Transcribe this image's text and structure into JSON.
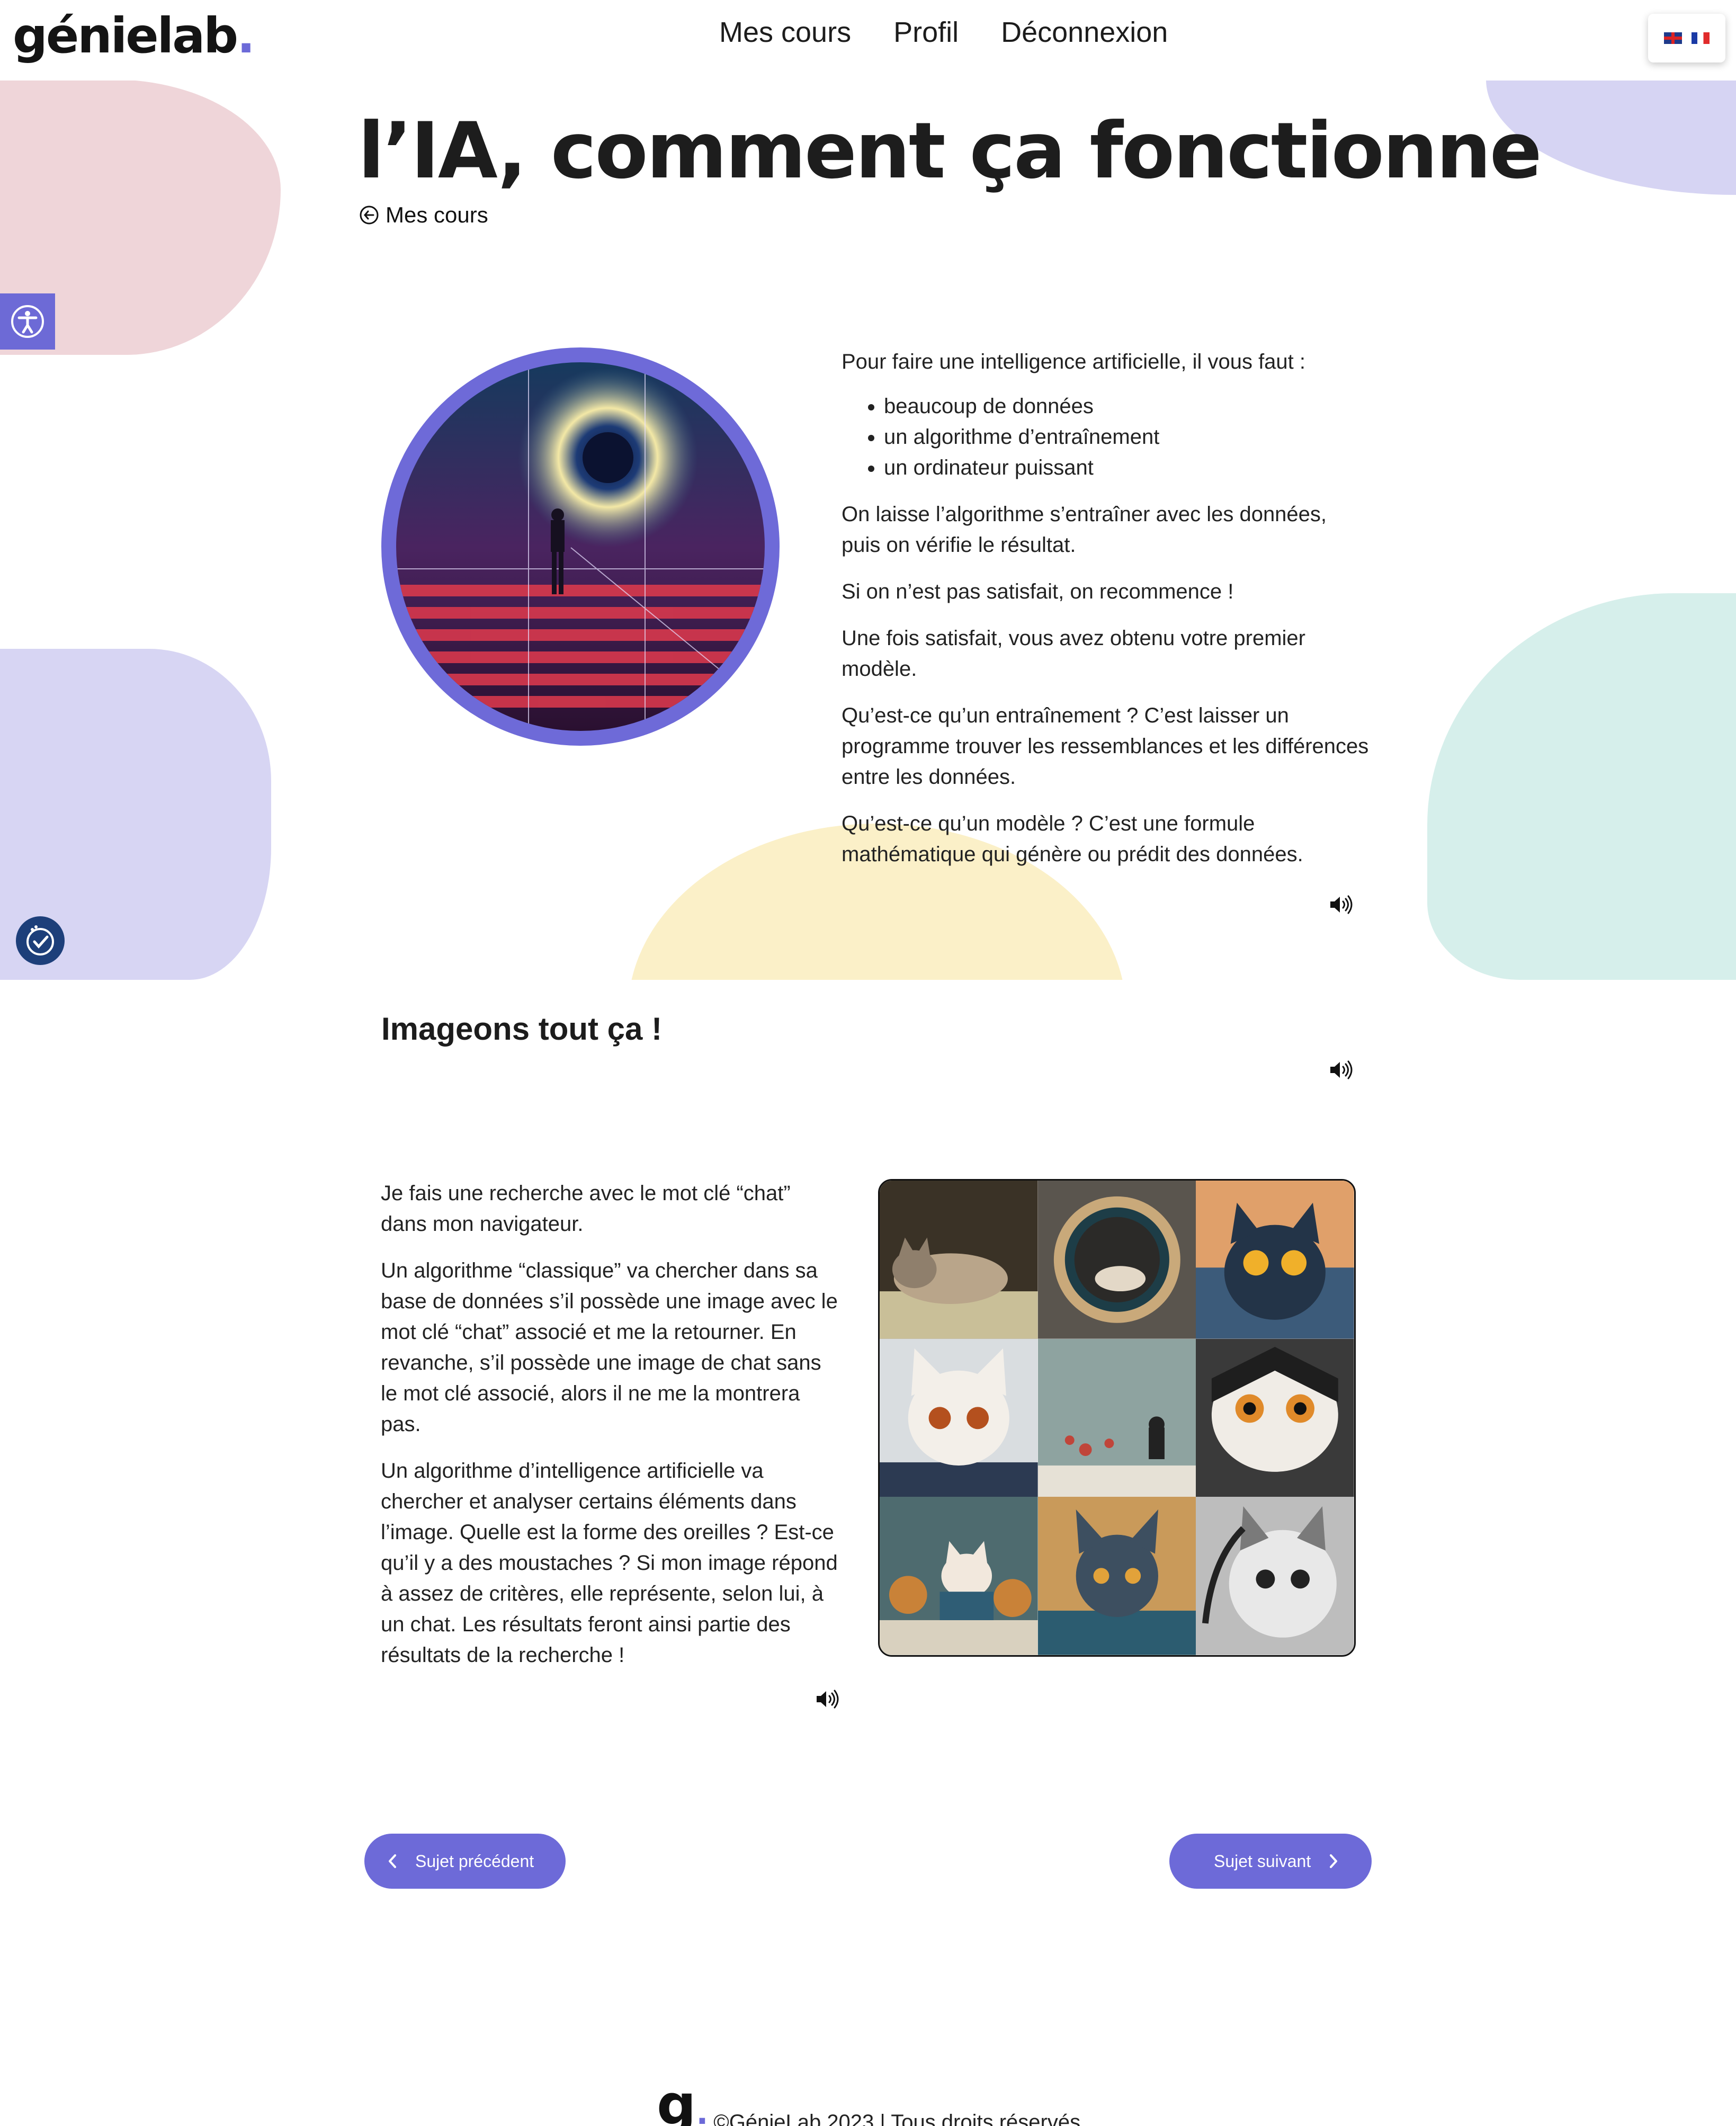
{
  "brand": {
    "name": "génielab",
    "dot": "."
  },
  "nav": [
    {
      "label": "Mes cours"
    },
    {
      "label": "Profil"
    },
    {
      "label": "Déconnexion"
    }
  ],
  "languages": [
    {
      "code": "en",
      "icon": "uk-flag-icon"
    },
    {
      "code": "fr",
      "icon": "fr-flag-icon"
    }
  ],
  "page": {
    "title": "l’IA, comment ça fonctionne",
    "back_label": "Mes cours"
  },
  "intro": {
    "lead": "Pour faire une intelligence artificielle, il vous faut :",
    "bullets": [
      "beaucoup de données",
      "un algorithme d’entraînement",
      "un ordinateur puissant"
    ],
    "paragraphs": [
      "On laisse l’algorithme s’entraîner avec les données, puis on vérifie le résultat.",
      "Si on n’est pas satisfait, on recommence !",
      "Une fois satisfait, vous avez obtenu votre premier modèle.",
      "Qu’est-ce qu’un entraînement ? C’est laisser un programme trouver les ressemblances et les différences entre les données.",
      "Qu’est-ce qu’un modèle ? C’est une formule mathématique qui génère ou prédit des données."
    ]
  },
  "section2": {
    "heading": "Imageons tout ça !",
    "paragraphs": [
      "Je fais une recherche avec le mot clé “chat” dans mon navigateur.",
      "Un algorithme “classique” va chercher dans sa base de données s’il possède une image avec le mot clé “chat” associé et me la retourner. En revanche, s’il possède une image de chat sans le mot clé associé, alors il ne me la montrera pas.",
      "Un algorithme d’intelligence artificielle va chercher et analyser certains éléments dans l’image. Quelle est la forme des oreilles ? Est-ce qu’il y a des moustaches ? Si mon image répond à assez de critères, elle représente, selon lui, à un chat. Les résultats feront ainsi partie des résultats de la recherche !"
    ]
  },
  "pagination": {
    "prev_label": "Sujet précédent",
    "next_label": "Sujet suivant"
  },
  "footer": {
    "logo": "g",
    "text": "©GénieLab 2023 | Tous droits réservés"
  },
  "colors": {
    "accent": "#6d6ad8",
    "blob_pink": "#efd5d9",
    "blob_lavender": "#d7d5f3",
    "blob_yellow": "#fbf0c8",
    "blob_mint": "#d6efeb"
  }
}
